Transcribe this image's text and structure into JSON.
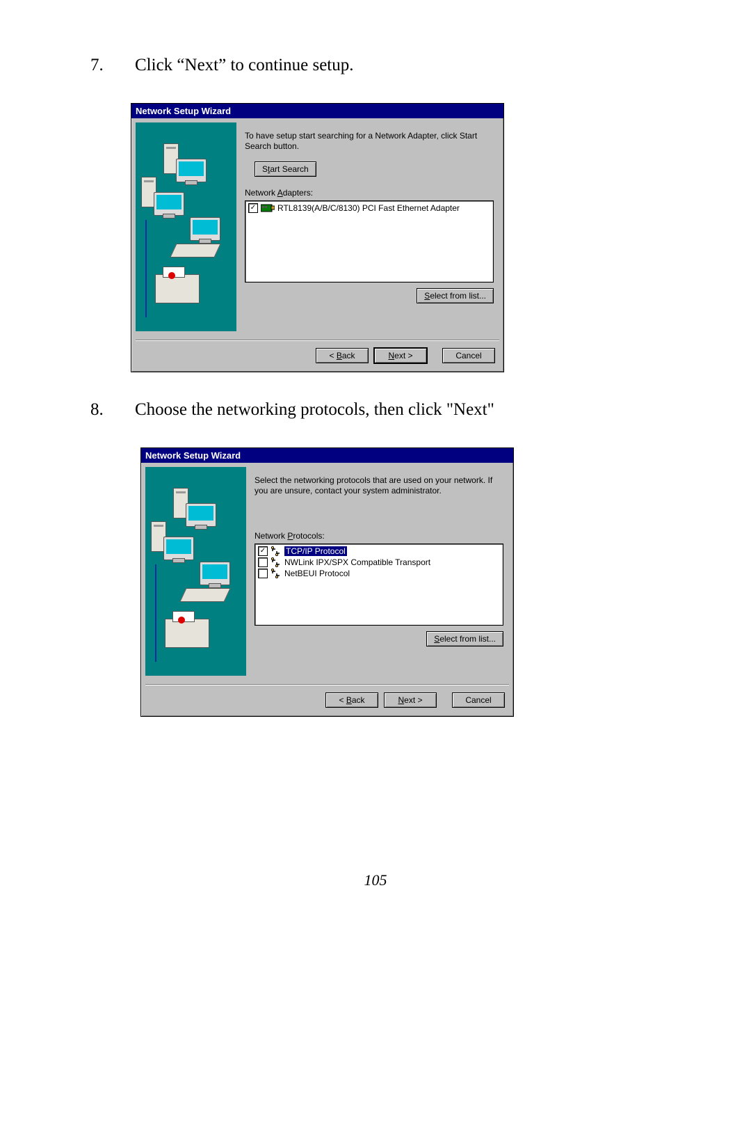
{
  "steps": [
    {
      "num": "7.",
      "text": "Click “Next” to continue setup."
    },
    {
      "num": "8.",
      "text": "Choose the networking protocols, then click \"Next\""
    }
  ],
  "dialog1": {
    "title": "Network Setup Wizard",
    "intro": "To have setup start searching for a Network Adapter, click Start Search button.",
    "start_search": "Start Search",
    "adapters_label": "Network Adapters:",
    "adapters": [
      {
        "checked": true,
        "label": "RTL8139(A/B/C/8130) PCI Fast Ethernet Adapter"
      }
    ],
    "select_from_list": "Select from list...",
    "back": "< Back",
    "next": "Next >",
    "cancel": "Cancel"
  },
  "dialog2": {
    "title": "Network Setup Wizard",
    "intro": "Select the networking protocols that are used on your network. If you are unsure, contact your system administrator.",
    "protocols_label": "Network Protocols:",
    "protocols": [
      {
        "checked": true,
        "selected": true,
        "label": "TCP/IP Protocol"
      },
      {
        "checked": false,
        "selected": false,
        "label": "NWLink IPX/SPX Compatible Transport"
      },
      {
        "checked": false,
        "selected": false,
        "label": "NetBEUI Protocol"
      }
    ],
    "select_from_list": "Select from list...",
    "back": "< Back",
    "next": "Next >",
    "cancel": "Cancel"
  },
  "page_number": "105"
}
